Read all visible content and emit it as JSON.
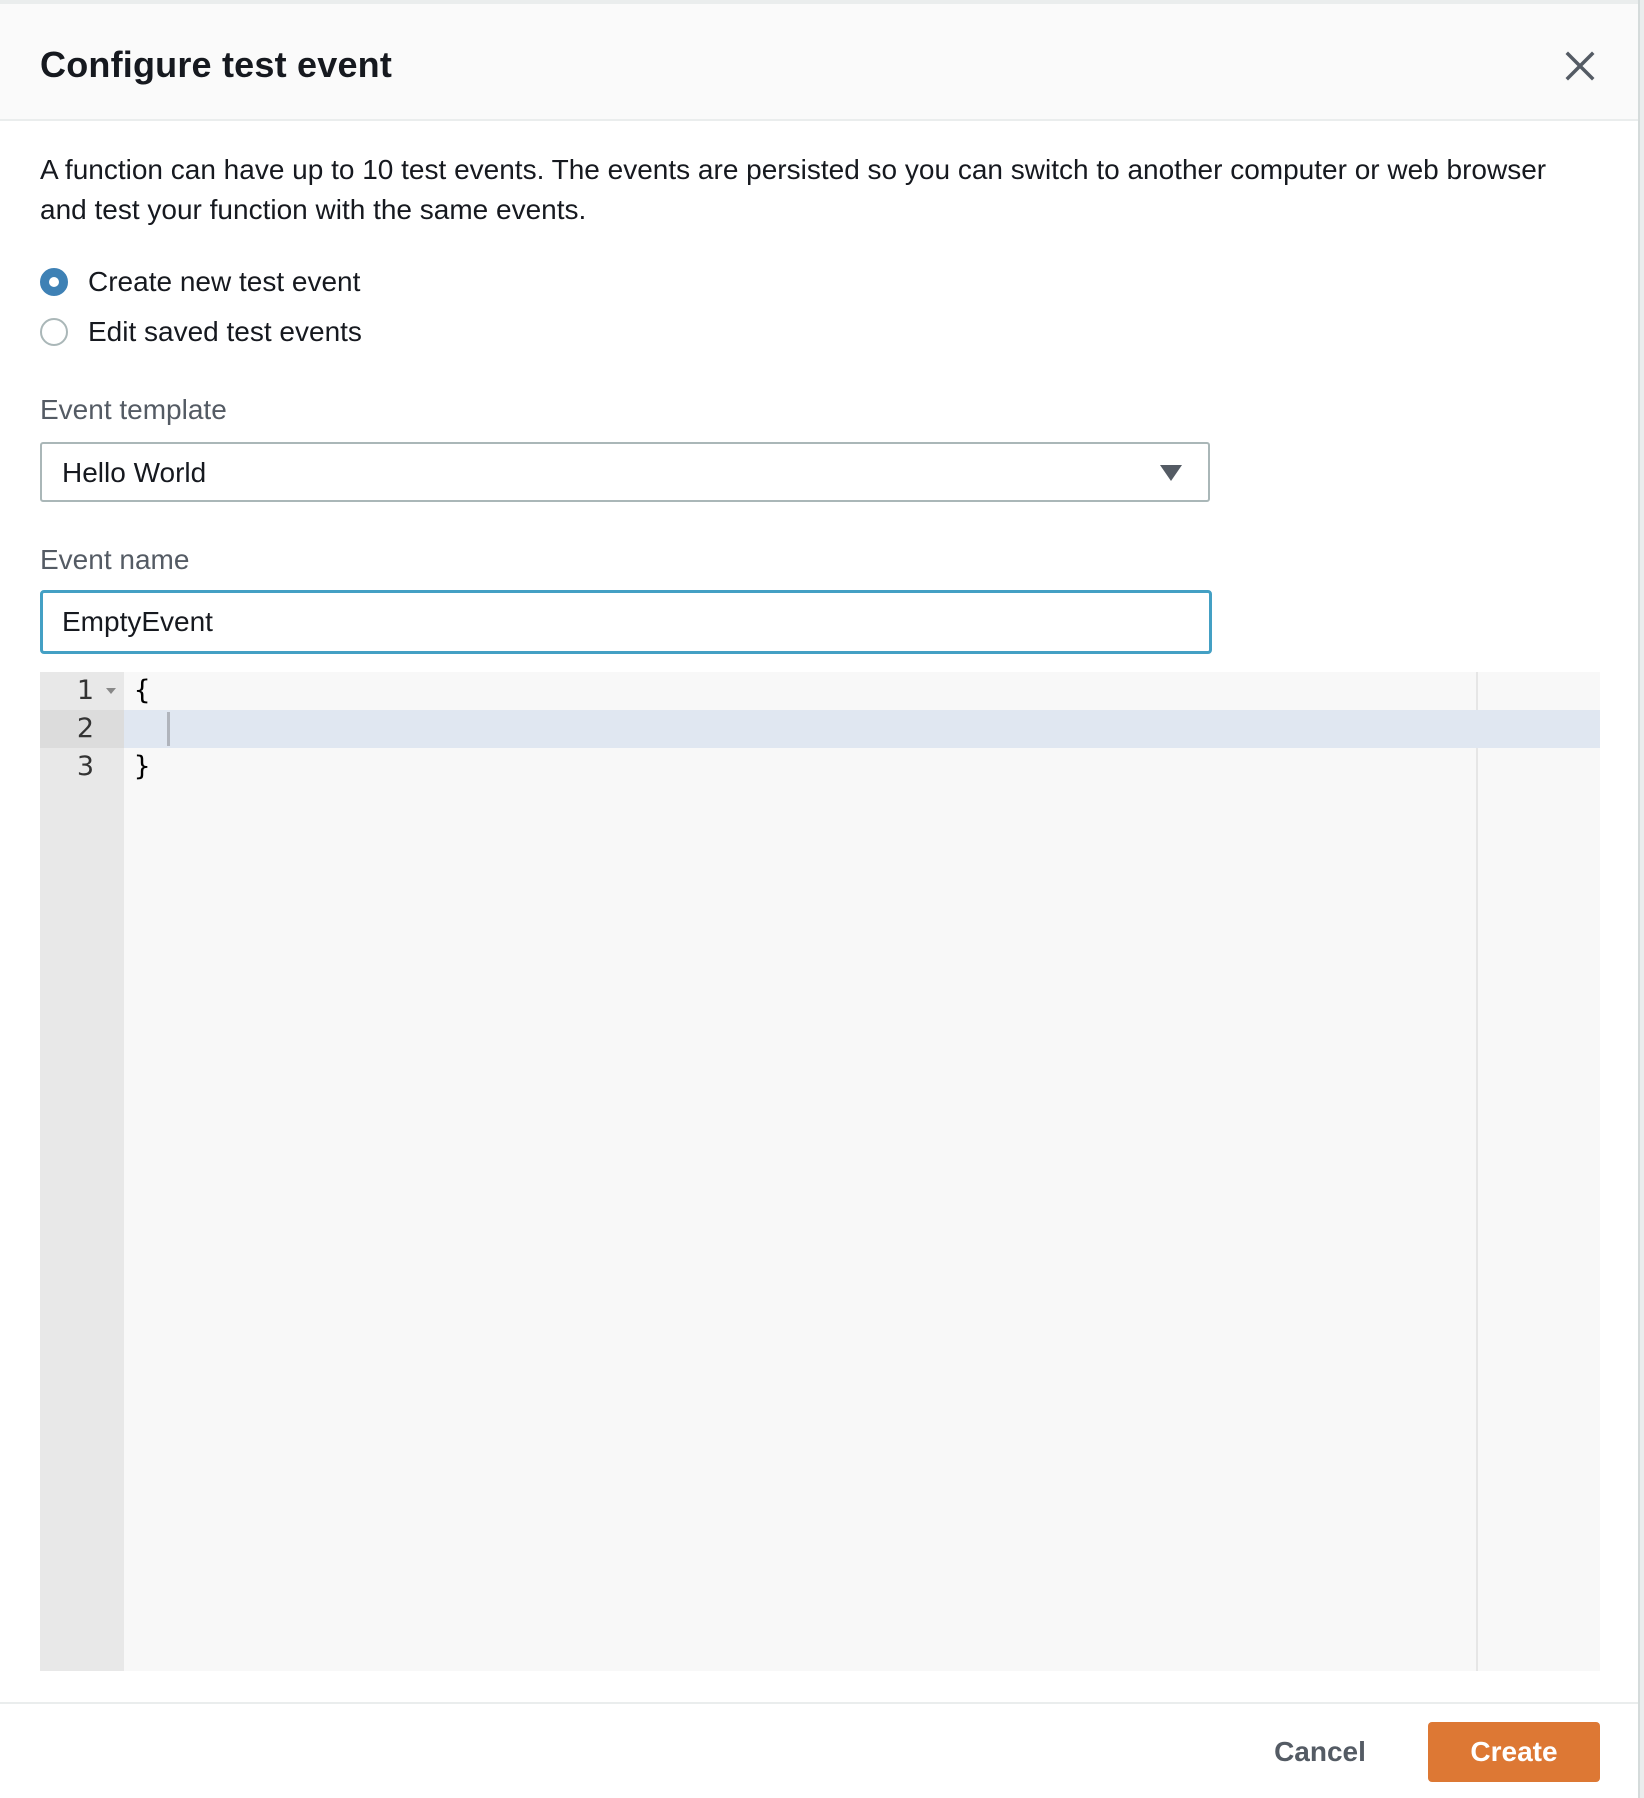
{
  "modal": {
    "title": "Configure test event",
    "close_icon": "close-icon",
    "description": "A function can have up to 10 test events. The events are persisted so you can switch to another computer or web browser and test your function with the same events."
  },
  "mode_options": [
    {
      "label": "Create new test event",
      "checked": true
    },
    {
      "label": "Edit saved test events",
      "checked": false
    }
  ],
  "event_template": {
    "label": "Event template",
    "selected": "Hello World",
    "caret_icon": "caret-down-icon"
  },
  "event_name": {
    "label": "Event name",
    "value": "EmptyEvent"
  },
  "editor": {
    "active_line": 2,
    "lines": [
      {
        "number": "1",
        "text": "{",
        "foldable": true
      },
      {
        "number": "2",
        "text": "",
        "foldable": false
      },
      {
        "number": "3",
        "text": "}",
        "foldable": false
      }
    ]
  },
  "footer": {
    "cancel_label": "Cancel",
    "create_label": "Create"
  },
  "colors": {
    "primary_button": "#dd7834",
    "focus_border": "#44a0c4",
    "radio_checked": "#3e81b5",
    "active_line": "#e0e7f1"
  }
}
